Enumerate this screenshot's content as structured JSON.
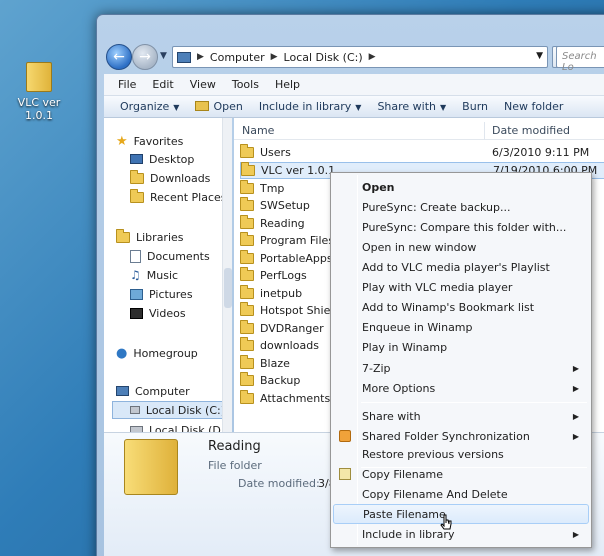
{
  "desktop": {
    "icon_label": "VLC ver 1.0.1"
  },
  "address_bar": {
    "crumbs": [
      "Computer",
      "Local Disk (C:)"
    ],
    "search_placeholder": "Search Lo"
  },
  "menu_bar": [
    "File",
    "Edit",
    "View",
    "Tools",
    "Help"
  ],
  "command_bar": {
    "organize": "Organize",
    "open": "Open",
    "include": "Include in library",
    "share": "Share with",
    "burn": "Burn",
    "new_folder": "New folder"
  },
  "nav_pane": {
    "favorites": "Favorites",
    "favorites_items": [
      "Desktop",
      "Downloads",
      "Recent Places"
    ],
    "libraries": "Libraries",
    "libraries_items": [
      "Documents",
      "Music",
      "Pictures",
      "Videos"
    ],
    "homegroup": "Homegroup",
    "computer": "Computer",
    "computer_items": [
      "Local Disk (C:)",
      "Local Disk (D:)"
    ]
  },
  "file_list": {
    "col_name": "Name",
    "col_date": "Date modified",
    "rows": [
      {
        "name": "Users",
        "date": "6/3/2010 9:11 PM"
      },
      {
        "name": "VLC ver 1.0.1",
        "date": "7/19/2010 6:00 PM"
      },
      {
        "name": "Tmp",
        "date": ""
      },
      {
        "name": "SWSetup",
        "date": ""
      },
      {
        "name": "Reading",
        "date": ""
      },
      {
        "name": "Program Files",
        "date": ""
      },
      {
        "name": "PortableApps",
        "date": ""
      },
      {
        "name": "PerfLogs",
        "date": ""
      },
      {
        "name": "inetpub",
        "date": ""
      },
      {
        "name": "Hotspot Shield",
        "date": ""
      },
      {
        "name": "DVDRanger",
        "date": ""
      },
      {
        "name": "downloads",
        "date": ""
      },
      {
        "name": "Blaze",
        "date": ""
      },
      {
        "name": "Backup",
        "date": ""
      },
      {
        "name": "Attachments",
        "date": ""
      }
    ]
  },
  "details": {
    "title": "Reading",
    "type": "File folder",
    "modified_label": "Date modified:",
    "modified_value": "3/8"
  },
  "context_menu": {
    "items": [
      "Open",
      "PureSync: Create backup...",
      "PureSync: Compare this folder with...",
      "Open in new window",
      "Add to VLC media player's Playlist",
      "Play with VLC media player",
      "Add to Winamp's Bookmark list",
      "Enqueue in Winamp",
      "Play in Winamp",
      "7-Zip",
      "More Options",
      "Share with",
      "Shared Folder Synchronization",
      "Restore previous versions",
      "Copy Filename",
      "Copy Filename And Delete",
      "Paste Filename",
      "Include in library"
    ]
  }
}
